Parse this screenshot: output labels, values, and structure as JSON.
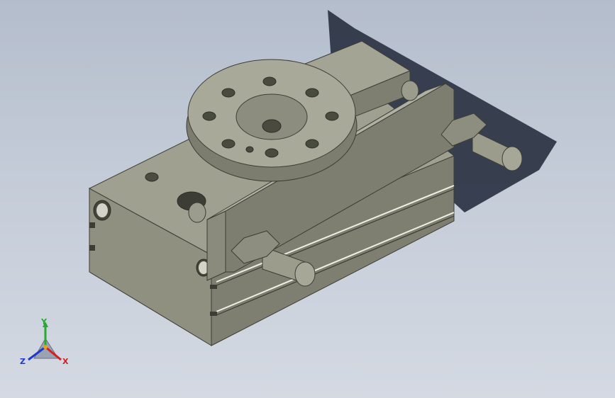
{
  "viewport": {
    "background_top": "#b4bdcc",
    "background_bottom": "#d4d9e2",
    "model_color": "#8e8f81",
    "model_shadow_color": "#252a36"
  },
  "triad": {
    "x_label": "X",
    "y_label": "Y",
    "z_label": "Z",
    "x_color": "#d22020",
    "y_color": "#2aa830",
    "z_color": "#2038c8"
  }
}
